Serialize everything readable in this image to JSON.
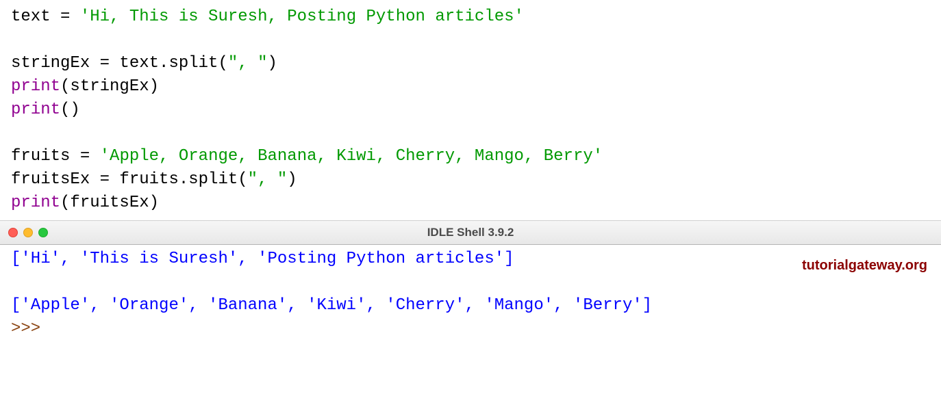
{
  "editor": {
    "lines": [
      {
        "parts": [
          {
            "t": "text ",
            "c": "black"
          },
          {
            "t": "=",
            "c": "black"
          },
          {
            "t": " ",
            "c": "black"
          },
          {
            "t": "'Hi, This is Suresh, Posting Python articles'",
            "c": "string"
          }
        ]
      },
      {
        "parts": []
      },
      {
        "parts": [
          {
            "t": "stringEx ",
            "c": "black"
          },
          {
            "t": "=",
            "c": "black"
          },
          {
            "t": " text.split(",
            "c": "black"
          },
          {
            "t": "\", \"",
            "c": "string"
          },
          {
            "t": ")",
            "c": "black"
          }
        ]
      },
      {
        "parts": [
          {
            "t": "print",
            "c": "builtin"
          },
          {
            "t": "(stringEx)",
            "c": "black"
          }
        ]
      },
      {
        "parts": [
          {
            "t": "print",
            "c": "builtin"
          },
          {
            "t": "()",
            "c": "black"
          }
        ]
      },
      {
        "parts": []
      },
      {
        "parts": [
          {
            "t": "fruits ",
            "c": "black"
          },
          {
            "t": "=",
            "c": "black"
          },
          {
            "t": " ",
            "c": "black"
          },
          {
            "t": "'Apple, Orange, Banana, Kiwi, Cherry, Mango, Berry'",
            "c": "string"
          }
        ]
      },
      {
        "parts": [
          {
            "t": "fruitsEx ",
            "c": "black"
          },
          {
            "t": "=",
            "c": "black"
          },
          {
            "t": " fruits.split(",
            "c": "black"
          },
          {
            "t": "\", \"",
            "c": "string"
          },
          {
            "t": ")",
            "c": "black"
          }
        ]
      },
      {
        "parts": [
          {
            "t": "print",
            "c": "builtin"
          },
          {
            "t": "(fruitsEx)",
            "c": "black"
          }
        ]
      }
    ]
  },
  "watermark": "tutorialgateway.org",
  "shell": {
    "title": "IDLE Shell 3.9.2",
    "output_lines": [
      {
        "parts": [
          {
            "t": "['Hi', 'This is Suresh', 'Posting Python articles']",
            "c": "blue"
          }
        ]
      },
      {
        "parts": []
      },
      {
        "parts": [
          {
            "t": "['Apple', 'Orange', 'Banana', 'Kiwi', 'Cherry', 'Mango', 'Berry']",
            "c": "blue"
          }
        ]
      },
      {
        "parts": [
          {
            "t": ">>> ",
            "c": "brown"
          }
        ]
      }
    ]
  },
  "colors": {
    "black": "#000000",
    "string": "#009900",
    "builtin": "#900090",
    "blue": "#0000ff",
    "brown": "#8b4513"
  }
}
